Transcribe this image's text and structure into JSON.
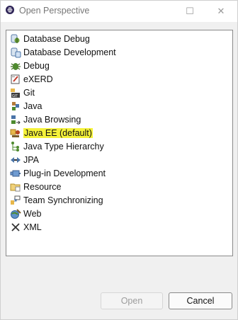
{
  "window": {
    "title": "Open Perspective",
    "maximize_glyph": "☐",
    "close_glyph": "✕"
  },
  "perspectives": [
    {
      "label": "Database Debug",
      "icon": "database-debug-icon"
    },
    {
      "label": "Database Development",
      "icon": "database-development-icon"
    },
    {
      "label": "Debug",
      "icon": "bug-icon"
    },
    {
      "label": "eXERD",
      "icon": "exerd-icon"
    },
    {
      "label": "Git",
      "icon": "git-icon"
    },
    {
      "label": "Java",
      "icon": "java-icon"
    },
    {
      "label": "Java Browsing",
      "icon": "java-browsing-icon"
    },
    {
      "label": "Java EE (default)",
      "icon": "java-ee-icon",
      "selected": true,
      "highlight": "#f5f23a"
    },
    {
      "label": "Java Type Hierarchy",
      "icon": "type-hierarchy-icon"
    },
    {
      "label": "JPA",
      "icon": "jpa-icon"
    },
    {
      "label": "Plug-in Development",
      "icon": "plugin-icon"
    },
    {
      "label": "Resource",
      "icon": "folder-icon"
    },
    {
      "label": "Team Synchronizing",
      "icon": "team-sync-icon"
    },
    {
      "label": "Web",
      "icon": "web-icon"
    },
    {
      "label": "XML",
      "icon": "xml-icon"
    }
  ],
  "buttons": {
    "open_label": "Open",
    "cancel_label": "Cancel"
  }
}
